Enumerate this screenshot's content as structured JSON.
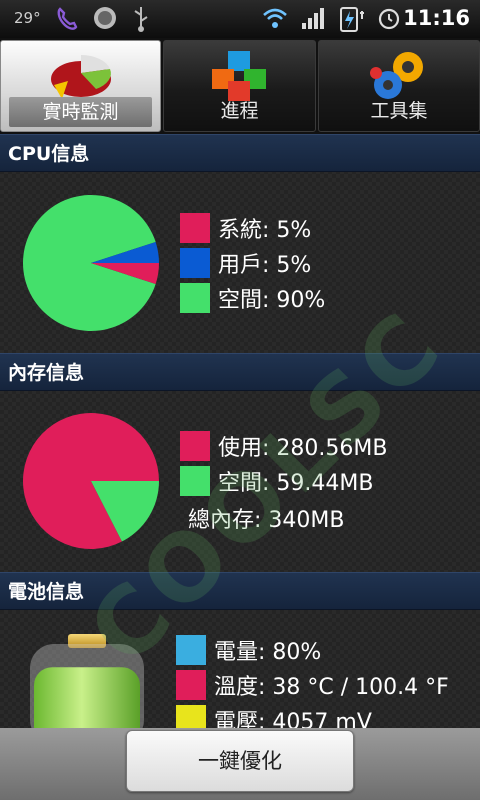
{
  "status_bar": {
    "temperature": "29°",
    "time": "11:16",
    "icons": [
      "viber-icon",
      "volume-icon",
      "usb-icon",
      "wifi-icon",
      "signal-icon",
      "battery-charging-icon",
      "alarm-icon"
    ]
  },
  "tabs": [
    {
      "label": "實時監測",
      "icon": "pie-chart-icon",
      "active": true
    },
    {
      "label": "進程",
      "icon": "cubes-icon",
      "active": false
    },
    {
      "label": "工具集",
      "icon": "gears-icon",
      "active": false
    }
  ],
  "sections": {
    "cpu": {
      "title": "CPU信息",
      "legend": [
        {
          "label": "系統: 5%",
          "color": "#e01e5a"
        },
        {
          "label": "用戶: 5%",
          "color": "#0a5bd3"
        },
        {
          "label": "空間: 90%",
          "color": "#44e06b"
        }
      ],
      "pie": [
        {
          "name": "系統",
          "value": 5,
          "color": "#e01e5a"
        },
        {
          "name": "用戶",
          "value": 5,
          "color": "#0a5bd3"
        },
        {
          "name": "空間",
          "value": 90,
          "color": "#44e06b"
        }
      ]
    },
    "memory": {
      "title": "內存信息",
      "legend": [
        {
          "label": "使用: 280.56MB",
          "color": "#e01e5a"
        },
        {
          "label": "空間: 59.44MB",
          "color": "#44e06b"
        }
      ],
      "total": "總內存: 340MB",
      "pie": [
        {
          "name": "使用",
          "value": 280.56,
          "color": "#e01e5a"
        },
        {
          "name": "空間",
          "value": 59.44,
          "color": "#44e06b"
        }
      ]
    },
    "battery": {
      "title": "電池信息",
      "level_percent": 80,
      "legend": [
        {
          "label": "電量: 80%",
          "color": "#3aaee0"
        },
        {
          "label": "溫度: 38 °C / 100.4 °F",
          "color": "#e01e5a"
        },
        {
          "label": "電壓: 4057 mV",
          "color": "#e8e41c"
        }
      ]
    }
  },
  "watermark": "COOLSC",
  "optimize_button": "一鍵優化"
}
